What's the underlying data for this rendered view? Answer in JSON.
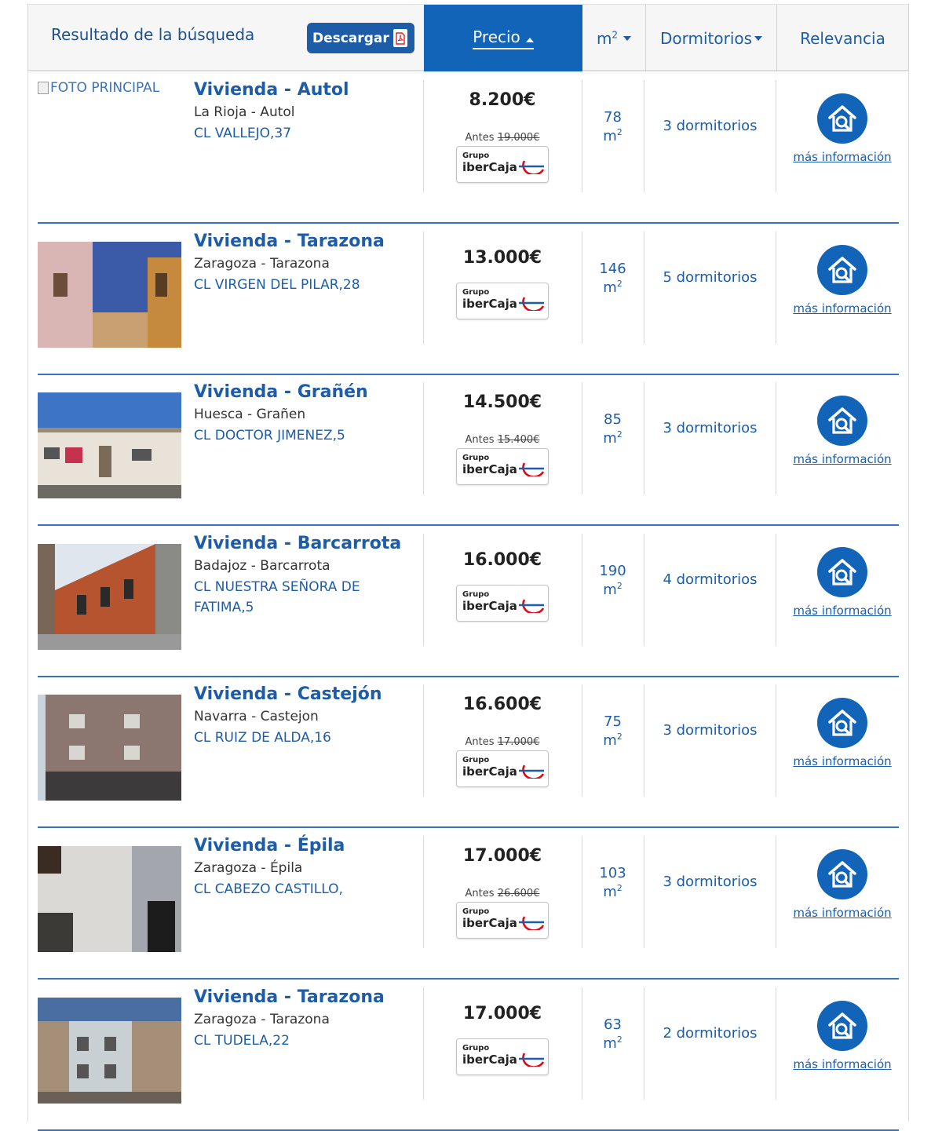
{
  "header": {
    "title": "Resultado de la búsqueda",
    "download_label": "Descargar",
    "sort_price": "Precio",
    "sort_m2_base": "m",
    "sort_m2_sup": "2",
    "sort_rooms": "Dormitorios",
    "sort_relevance": "Relevancia"
  },
  "broken_image_alt": "FOTO PRINCIPAL",
  "listings": [
    {
      "title": "Vivienda - Autol",
      "region": "La Rioja - Autol",
      "street": "CL VALLEJO,37",
      "price": "8.200€",
      "before_label": "Antes",
      "before_price": "19.000€",
      "m2": "78",
      "rooms": "3 dormitorios",
      "info": "más información",
      "badge_group": "Grupo",
      "badge_brand": "iberCaja"
    },
    {
      "title": "Vivienda - Tarazona",
      "region": "Zaragoza - Tarazona",
      "street": "CL VIRGEN DEL PILAR,28",
      "price": "13.000€",
      "m2": "146",
      "rooms": "5 dormitorios",
      "info": "más información",
      "badge_group": "Grupo",
      "badge_brand": "iberCaja"
    },
    {
      "title": "Vivienda - Grañén",
      "region": "Huesca - Grañen",
      "street": "CL DOCTOR JIMENEZ,5",
      "price": "14.500€",
      "before_label": "Antes",
      "before_price": "15.400€",
      "m2": "85",
      "rooms": "3 dormitorios",
      "info": "más información",
      "badge_group": "Grupo",
      "badge_brand": "iberCaja"
    },
    {
      "title": "Vivienda - Barcarrota",
      "region": "Badajoz - Barcarrota",
      "street": "CL NUESTRA SEÑORA DE FATIMA,5",
      "price": "16.000€",
      "m2": "190",
      "rooms": "4 dormitorios",
      "info": "más información",
      "badge_group": "Grupo",
      "badge_brand": "iberCaja"
    },
    {
      "title": "Vivienda - Castejón",
      "region": "Navarra - Castejon",
      "street": "CL RUIZ DE ALDA,16",
      "price": "16.600€",
      "before_label": "Antes",
      "before_price": "17.000€",
      "m2": "75",
      "rooms": "3 dormitorios",
      "info": "más información",
      "badge_group": "Grupo",
      "badge_brand": "iberCaja"
    },
    {
      "title": "Vivienda - Épila",
      "region": "Zaragoza - Épila",
      "street": "CL CABEZO CASTILLO,",
      "price": "17.000€",
      "before_label": "Antes",
      "before_price": "26.600€",
      "m2": "103",
      "rooms": "3 dormitorios",
      "info": "más información",
      "badge_group": "Grupo",
      "badge_brand": "iberCaja"
    },
    {
      "title": "Vivienda - Tarazona",
      "region": "Zaragoza - Tarazona",
      "street": "CL TUDELA,22",
      "price": "17.000€",
      "m2": "63",
      "rooms": "2 dormitorios",
      "info": "más información",
      "badge_group": "Grupo",
      "badge_brand": "iberCaja"
    }
  ],
  "m2_unit_base": "m",
  "m2_unit_sup": "2",
  "colors": {
    "primary": "#1164b8",
    "link": "#1d5da8",
    "separator": "#3a72b6",
    "ibercaja_red": "#e30613"
  }
}
